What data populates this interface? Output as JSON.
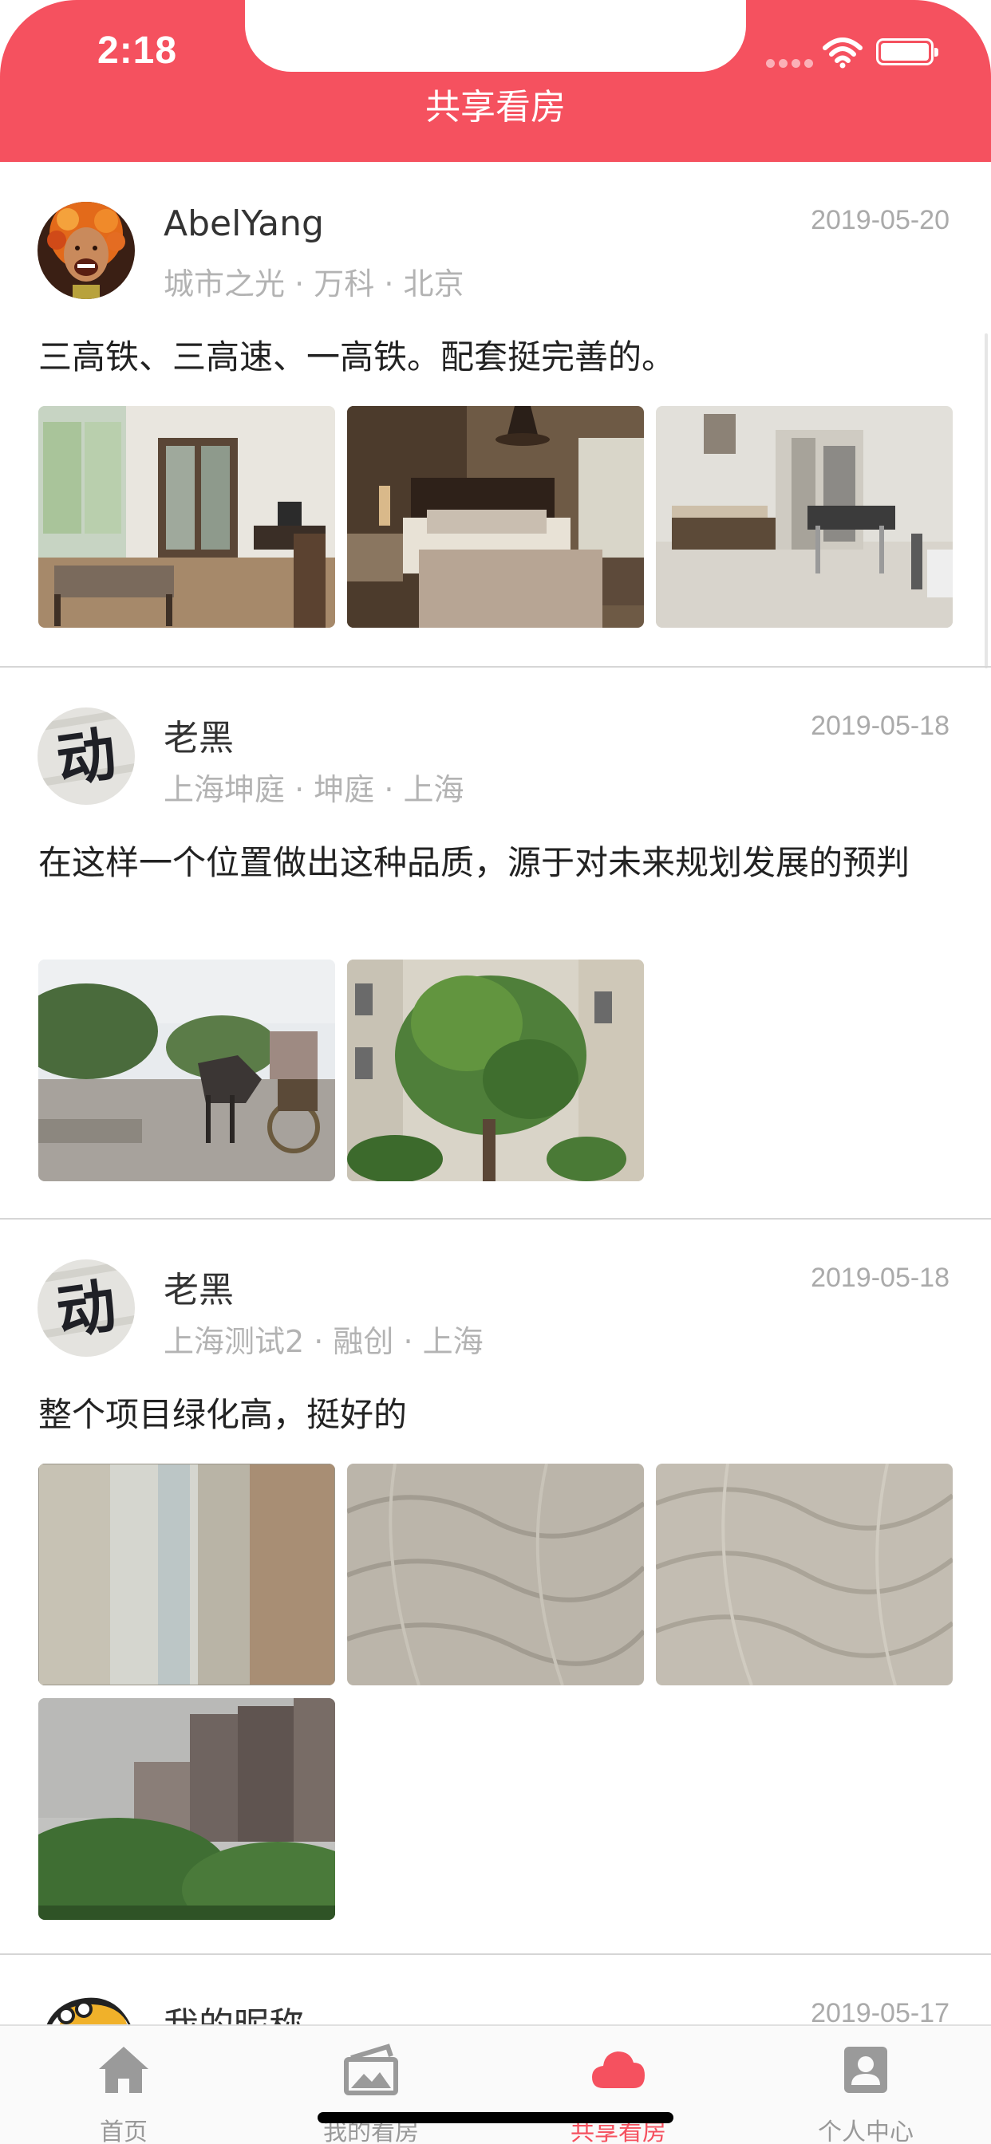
{
  "status_bar": {
    "time": "2:18"
  },
  "nav": {
    "title": "共享看房"
  },
  "posts": [
    {
      "username": "AbelYang",
      "location": "城市之光 · 万科 · 北京",
      "date": "2019-05-20",
      "content": "三高铁、三高速、一高铁。配套挺完善的。",
      "photos": [
        "living-room-photo",
        "bedroom-photo",
        "dining-room-photo"
      ]
    },
    {
      "username": "老黑",
      "location": "上海坤庭 · 坤庭 · 上海",
      "date": "2019-05-18",
      "content": "在这样一个位置做出这种品质，源于对未来规划发展的预判",
      "photos": [
        "horse-carriage-sculpture-photo",
        "tree-photo"
      ]
    },
    {
      "username": "老黑",
      "location": "上海测试2 · 融创 · 上海",
      "date": "2019-05-18",
      "content": "整个项目绿化高，挺好的",
      "photos": [
        "wood-floor-photo",
        "wall-texture-photo",
        "wall-texture-photo",
        "window-screen-view-photo"
      ]
    },
    {
      "username": "我的昵称",
      "date": "2019-05-17"
    }
  ],
  "tabbar": {
    "items": [
      {
        "label": "首页",
        "icon": "home-icon"
      },
      {
        "label": "我的看房",
        "icon": "photo-album-icon"
      },
      {
        "label": "共享看房",
        "icon": "cloud-icon",
        "active": true
      },
      {
        "label": "个人中心",
        "icon": "person-icon"
      }
    ]
  },
  "colors": {
    "accent": "#f5515f",
    "text": "#333333",
    "muted": "#b3b3b3"
  }
}
